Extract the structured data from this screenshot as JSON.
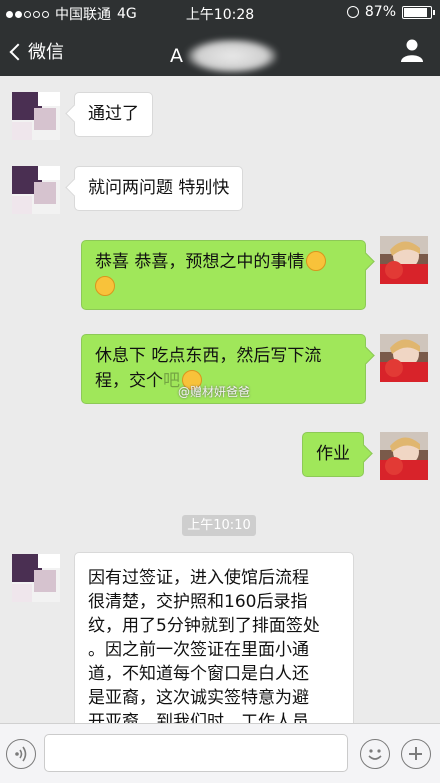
{
  "status": {
    "carrier": "中国联通",
    "network": "4G",
    "time": "上午10:28",
    "battery": "87%",
    "battery_level": 0.87
  },
  "nav": {
    "back_label": "微信",
    "title_initial": "A"
  },
  "messages": [
    {
      "side": "left",
      "text": "通过了"
    },
    {
      "side": "left",
      "text": "就问两问题 特别快"
    },
    {
      "side": "right",
      "line1": "恭喜 恭喜，预想之中的事情",
      "emoji": "grinning-emoji"
    },
    {
      "side": "right",
      "line1": "休息下 吃点东西，然后写下流",
      "line2": "程，交个",
      "line2_end": "吧"
    },
    {
      "side": "right",
      "text": "作业"
    },
    {
      "side": "left",
      "lines": [
        "因有过签证，进入使馆后流程",
        "很清楚，交护照和160后录指",
        "纹，用了5分钟就到了排面签处",
        "。因之前一次签证在里面小通",
        "道，不知道每个窗口是白人还",
        "是亚裔，这次诚实签特意为避",
        "开亚裔，到我们时，工作人员"
      ]
    }
  ],
  "watermark": "@赠材妍爸爸",
  "timestamp": "上午10:10",
  "colors": {
    "bar_bg": "#2e3132",
    "chat_bg": "#ebebeb",
    "sent_bubble": "#a0e75a",
    "received_bubble": "#ffffff"
  }
}
